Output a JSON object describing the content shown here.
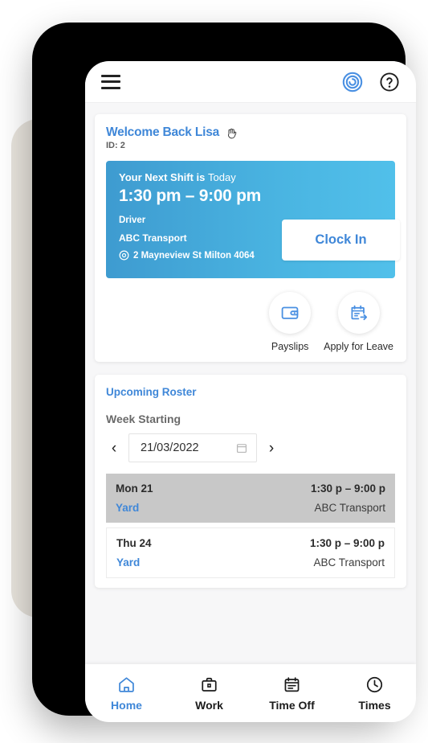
{
  "header": {
    "menu_icon": "hamburger-menu-icon",
    "logo_icon": "spiral-target-logo-icon",
    "help_icon": "question-mark-help-icon"
  },
  "welcome": {
    "title": "Welcome Back Lisa",
    "wave_icon": "waving-hand-icon",
    "employee_id": "ID: 2"
  },
  "next_shift": {
    "headline_bold": "Your Next Shift is",
    "headline_light": "Today",
    "time_range": "1:30 pm – 9:00 pm",
    "role": "Driver",
    "company": "ABC Transport",
    "location_icon": "location-pin-icon",
    "address": "2 Mayneview St Milton 4064",
    "clock_in_label": "Clock In",
    "gradient_from": "#3e9bd0",
    "gradient_to": "#51c0ea"
  },
  "quick_actions": [
    {
      "label": "Payslips",
      "icon": "wallet-payslips-icon"
    },
    {
      "label": "Apply for Leave",
      "icon": "calendar-leave-request-icon"
    }
  ],
  "roster": {
    "title": "Upcoming Roster",
    "week_starting_label": "Week Starting",
    "prev_icon": "chevron-left-icon",
    "next_icon": "chevron-right-icon",
    "date_value": "21/03/2022",
    "calendar_icon": "calendar-icon",
    "rows": [
      {
        "day": "Mon 21",
        "hours": "1:30 p – 9:00 p",
        "area": "Yard",
        "company": "ABC Transport",
        "highlighted": true
      },
      {
        "day": "Thu 24",
        "hours": "1:30 p – 9:00 p",
        "area": "Yard",
        "company": "ABC Transport",
        "highlighted": false
      }
    ]
  },
  "bottom_nav": {
    "active": "Home",
    "items": [
      {
        "label": "Home",
        "icon": "home-icon",
        "active": true
      },
      {
        "label": "Work",
        "icon": "briefcase-icon",
        "active": false
      },
      {
        "label": "Time Off",
        "icon": "calendar-time-off-icon",
        "active": false
      },
      {
        "label": "Times",
        "icon": "clock-icon",
        "active": false
      }
    ]
  },
  "theme": {
    "accent_blue": "#3f87d8",
    "page_background": "#f7f7f8",
    "highlight_row": "#c8c8c8"
  }
}
